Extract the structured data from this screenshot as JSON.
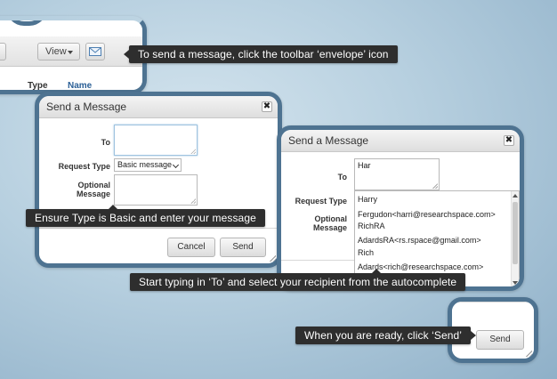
{
  "toolbar": {
    "view_label": "View",
    "col_type": "Type",
    "col_name": "Name",
    "envelope_icon": "envelope-icon",
    "dropdown_icon": "caret-down-icon"
  },
  "dialog_left": {
    "title": "Send a Message",
    "to_label": "To",
    "request_type_label": "Request Type",
    "request_type_value": "Basic message",
    "optional_label_1": "Optional",
    "optional_label_2": "Message",
    "cancel_label": "Cancel",
    "send_label": "Send",
    "close_glyph": "✖"
  },
  "dialog_right": {
    "title": "Send a Message",
    "to_label": "To",
    "to_value": "Har",
    "request_type_label": "Request Type",
    "optional_label_1": "Optional",
    "optional_label_2": "Message",
    "close_glyph": "✖",
    "suggestions": [
      {
        "name": "Harry",
        "detail": "Fergudon<harri@researchspace.com>"
      },
      {
        "name": "RichRA",
        "detail": "AdardsRA<rs.rspace@gmail.com>"
      },
      {
        "name": "Rich",
        "detail": "Adards<rich@researchspace.com>"
      }
    ]
  },
  "send_frame": {
    "send_label": "Send"
  },
  "callouts": {
    "envelope": "To send a message, click the toolbar ‘envelope’ icon",
    "type": "Ensure Type is Basic and enter your message",
    "autocomplete": "Start typing in ‘To’ and select your recipient from the autocomplete",
    "send": "When you are ready, click ‘Send’"
  },
  "colors": {
    "frame_border": "#4e7391",
    "callout_bg": "#2e2e2e",
    "header_link": "#2a5f96"
  }
}
